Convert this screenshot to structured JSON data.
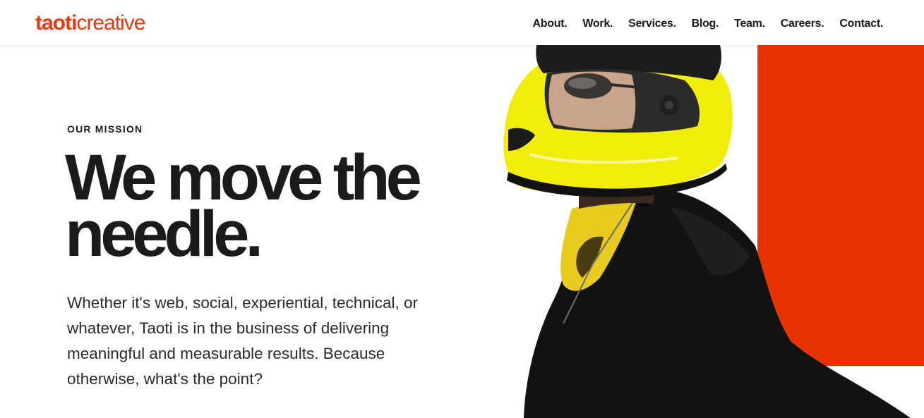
{
  "brand": {
    "name_bold": "taoti",
    "name_light": "creative",
    "color": "#e53a12"
  },
  "nav": {
    "items": [
      {
        "label": "About."
      },
      {
        "label": "Work."
      },
      {
        "label": "Services."
      },
      {
        "label": "Blog."
      },
      {
        "label": "Team."
      },
      {
        "label": "Careers."
      },
      {
        "label": "Contact."
      }
    ]
  },
  "hero": {
    "eyebrow": "OUR MISSION",
    "headline_line1": "We move the",
    "headline_line2": "needle.",
    "body": "Whether it's web, social, experiential, technical, or whatever, Taoti is in the business of delivering meaningful and measurable results. Because otherwise, what's the point?",
    "image_subject": "person-in-yellow-helmet",
    "colors": {
      "accent_block": "#e83200",
      "helmet": "#f2ec0a",
      "jacket": "#121212"
    }
  }
}
